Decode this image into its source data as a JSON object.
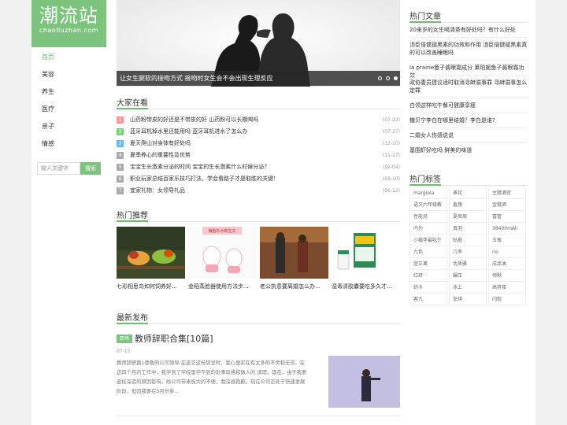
{
  "logo": {
    "cn": "潮流站",
    "en": "chaolluzhan.com"
  },
  "nav": [
    "首页",
    "美容",
    "养生",
    "医疗",
    "亲子",
    "情感"
  ],
  "search": {
    "placeholder": "输入关键字",
    "button": "搜索"
  },
  "hero": {
    "caption": "让女生腿软的接吻方式 接吻时女生会不会出现生理反应"
  },
  "dajia": {
    "title": "大家在看",
    "items": [
      {
        "num": "1",
        "title": "山药粉带皮的好还是不带皮的好 山药粉可以长期喝吗",
        "date": "(07-22)",
        "color": "#f39a9a"
      },
      {
        "num": "2",
        "title": "蓝牙耳机掉水里还能用吗 蓝牙耳机进水了怎么办",
        "date": "(07-27)",
        "color": "#7ccf7e"
      },
      {
        "num": "3",
        "title": "夏天爬山对身体有好处吗",
        "date": "(12-10)",
        "color": "#6fb7e6"
      },
      {
        "num": "4",
        "title": "夏季养心的重要性及优势",
        "date": "(11-27)",
        "color": "#aaa"
      },
      {
        "num": "5",
        "title": "宝宝生长激素分泌的时间 宝宝的生长激素什么时候分泌？",
        "date": "(02-04)",
        "color": "#aaa"
      },
      {
        "num": "6",
        "title": "职业玩家总结百家乐技巧打法，学会看路子才是取胜的关键！",
        "date": "(03-10)",
        "color": "#aaa"
      },
      {
        "num": "7",
        "title": "宜家礼物：女领导礼品",
        "date": "(06-12)",
        "color": "#aaa"
      }
    ]
  },
  "remen": {
    "title": "热门推荐",
    "cards": [
      {
        "caption": "七彩相思鸟如何饲养好..."
      },
      {
        "caption": "金稻蒸脸器使用方法步..."
      },
      {
        "caption": "老公执意要离婚怎么办..."
      },
      {
        "caption": "湿毒清胶囊要吃多久才..."
      }
    ],
    "poster_text": "萌胎补水新生文"
  },
  "latest": {
    "title": "最新发布",
    "badge": "职场",
    "post_title": "教师辞职合集[10篇]",
    "date": "07-15",
    "excerpt_lines": [
      "教师辞职篇1尊敬的公司领导:在这交这份辞呈时，我心里实在有太多的不舍和无奈。在",
      "这四个月的工作中，我学到了学校里学不到的处事风格和做人的 道理。现在，由于我要",
      "返校深造的原因影响，给公司带来极大的不便，我深感抱歉。现在公司正处于快速发展",
      "阶段，但因我要在5月份参..."
    ]
  },
  "hot_articles": {
    "title": "热门文章",
    "items": [
      "20来岁的女生喝清茶有好处吗？有什么好处",
      "汤臣倍健褪黑素的功效和作用 汤臣倍健褪黑素真的可以改善睡眠吗",
      "la prairie鱼子酱眼霜成分 莱珀妮鱼子酱眼霜功效",
      "政协委员建议适时取消寻衅滋事罪 寻衅滋事怎么定罪",
      "白领这样吃午餐可健康享瘦",
      "糖贝宁李白在哪里结婚？李白是谁?",
      "二婚女人伤感说说",
      "基围虾好吃吗 鲜美的味道"
    ]
  },
  "hot_tags": {
    "title": "热门标签",
    "tags": [
      "margiela",
      "蒸化",
      "主题酒宫",
      "语文六年级教",
      "羞愧",
      "金箍酒",
      "性能另",
      "夏商周",
      "富管",
      "内为",
      "真羽",
      "38400mAh",
      "小猫李最吃什",
      "贴报",
      "玉瓶",
      "九色",
      "几率",
      "rio",
      "胆正果",
      "优质雅",
      "成品油",
      "红舒",
      "碾压",
      "倾默",
      "奶卡",
      "冰上",
      "高势楼",
      "客九",
      "安琪",
      "闪现"
    ]
  },
  "colors": {
    "accent": "#6ebd6f",
    "logo_bg": "#7cc47d"
  }
}
